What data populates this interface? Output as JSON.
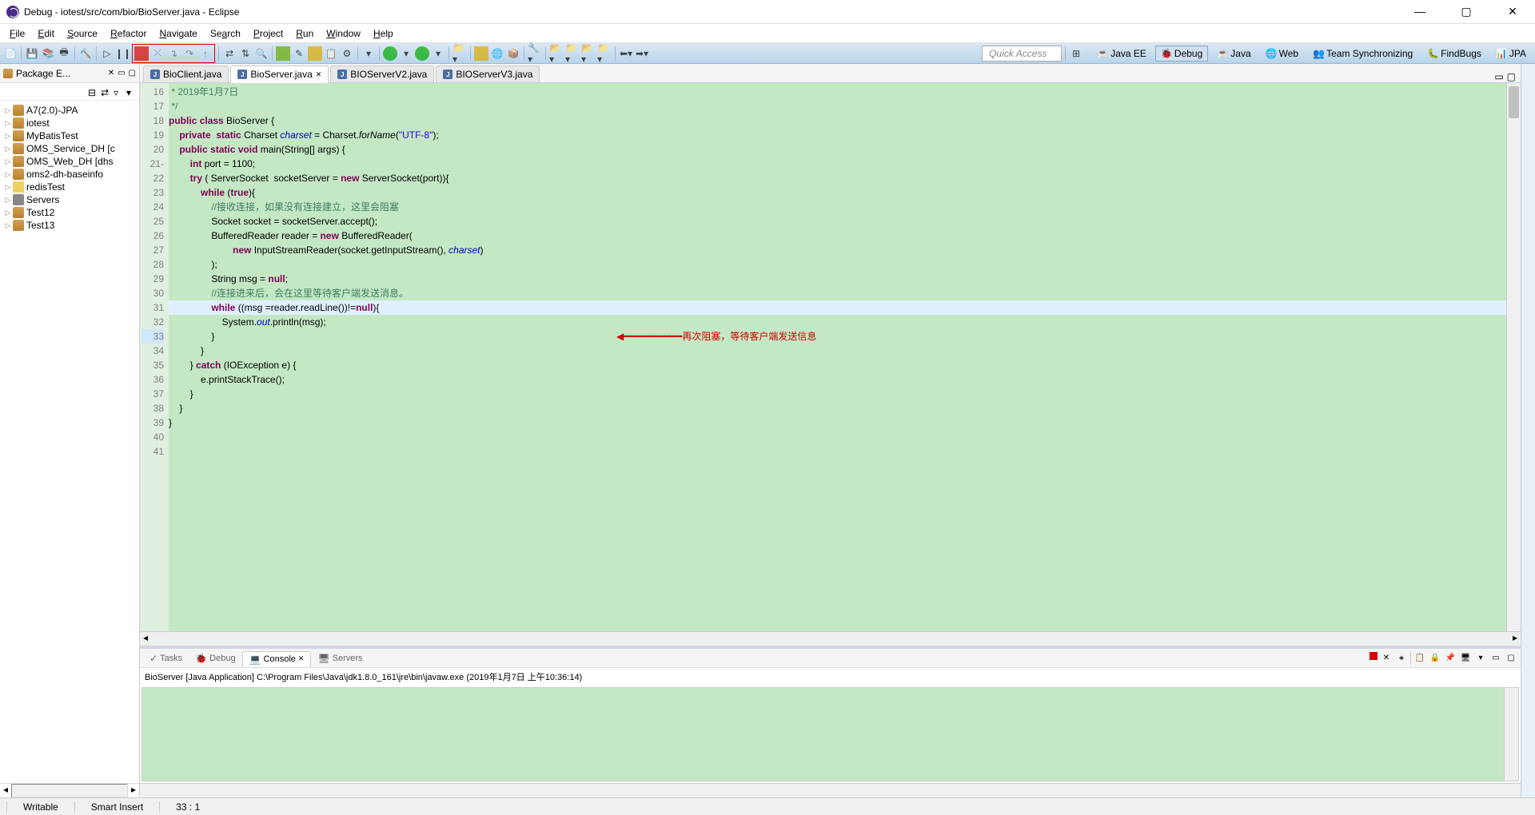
{
  "title": "Debug - iotest/src/com/bio/BioServer.java - Eclipse",
  "menu": [
    "File",
    "Edit",
    "Source",
    "Refactor",
    "Navigate",
    "Search",
    "Project",
    "Run",
    "Window",
    "Help"
  ],
  "menuKeys": [
    "F",
    "E",
    "S",
    "R",
    "N",
    "a",
    "P",
    "R",
    "W",
    "H"
  ],
  "quickAccess": "Quick Access",
  "perspectives": [
    {
      "label": "Java EE",
      "icon": "javaee"
    },
    {
      "label": "Debug",
      "icon": "debug",
      "active": true
    },
    {
      "label": "Java",
      "icon": "java"
    },
    {
      "label": "Web",
      "icon": "web"
    },
    {
      "label": "Team Synchronizing",
      "icon": "team"
    },
    {
      "label": "FindBugs",
      "icon": "findbugs"
    },
    {
      "label": "JPA",
      "icon": "jpa"
    }
  ],
  "packageExplorer": {
    "title": "Package E...",
    "items": [
      {
        "label": "A7(2.0)-JPA",
        "icon": "pkg"
      },
      {
        "label": "iotest",
        "icon": "pkg"
      },
      {
        "label": "MyBatisTest",
        "icon": "pkg"
      },
      {
        "label": "OMS_Service_DH [c",
        "icon": "pkg"
      },
      {
        "label": "OMS_Web_DH [dhs",
        "icon": "pkg"
      },
      {
        "label": "oms2-dh-baseinfo",
        "icon": "pkg"
      },
      {
        "label": "redisTest",
        "icon": "fldr"
      },
      {
        "label": "Servers",
        "icon": "srv"
      },
      {
        "label": "Test12",
        "icon": "pkg"
      },
      {
        "label": "Test13",
        "icon": "pkg"
      }
    ]
  },
  "editorTabs": [
    {
      "label": "BioClient.java"
    },
    {
      "label": "BioServer.java",
      "active": true
    },
    {
      "label": "BIOServerV2.java"
    },
    {
      "label": "BIOServerV3.java"
    }
  ],
  "code": {
    "startLine": 16,
    "currentLine": 33,
    "annotation": "再次阻塞，等待客户端发送信息",
    "lines": [
      {
        "n": 16,
        "t": " * 2019年1月7日",
        "cls": "cmt"
      },
      {
        "n": 17,
        "t": " */",
        "cls": "cmt"
      },
      {
        "n": 18,
        "html": "<span class='kw'>public</span> <span class='kw'>class</span> BioServer {"
      },
      {
        "n": 19,
        "t": ""
      },
      {
        "n": 20,
        "html": "    <span class='kw'>private</span>  <span class='kw'>static</span> Charset <span class='fld'>charset</span> = Charset.<span style='font-style:italic'>forName</span>(<span class='str'>\"UTF-8\"</span>);"
      },
      {
        "n": 21,
        "html": "    <span class='kw'>public</span> <span class='kw'>static</span> <span class='kw'>void</span> main(String[] args) {",
        "mark": "-"
      },
      {
        "n": 22,
        "html": "        <span class='kw'>int</span> port = 1100;"
      },
      {
        "n": 23,
        "t": ""
      },
      {
        "n": 24,
        "html": "        <span class='kw'>try</span> ( ServerSocket  socketServer = <span class='kw'>new</span> ServerSocket(port)){"
      },
      {
        "n": 25,
        "html": "            <span class='kw'>while</span> (<span class='kw'>true</span>){"
      },
      {
        "n": 26,
        "html": "                <span class='cmt'>//接收连接，如果没有连接建立，这里会阻塞</span>"
      },
      {
        "n": 27,
        "html": "                Socket socket = socketServer.accept();"
      },
      {
        "n": 28,
        "html": "                BufferedReader reader = <span class='kw'>new</span> BufferedReader("
      },
      {
        "n": 29,
        "html": "                        <span class='kw'>new</span> InputStreamReader(socket.getInputStream(), <span class='fld'>charset</span>)"
      },
      {
        "n": 30,
        "html": "                );"
      },
      {
        "n": 31,
        "html": "                String msg = <span class='kw'>null</span>;"
      },
      {
        "n": 32,
        "html": "                <span class='cmt'>//连接进来后，会在这里等待客户端发送消息。</span>"
      },
      {
        "n": 33,
        "html": "                <span class='kw'>while</span> ((msg =reader.readLine())!=<span class='kw'>null</span>){",
        "cur": true
      },
      {
        "n": 34,
        "html": "                    System.<span class='fld'>out</span>.println(msg);"
      },
      {
        "n": 35,
        "html": "                }"
      },
      {
        "n": 36,
        "html": "            }"
      },
      {
        "n": 37,
        "html": "        } <span class='kw'>catch</span> (IOException e) {"
      },
      {
        "n": 38,
        "html": "            e.printStackTrace();"
      },
      {
        "n": 39,
        "html": "        }"
      },
      {
        "n": 40,
        "html": "    }"
      },
      {
        "n": 41,
        "html": "}"
      }
    ]
  },
  "consoleTabs": [
    {
      "label": "Tasks"
    },
    {
      "label": "Debug"
    },
    {
      "label": "Console",
      "active": true
    },
    {
      "label": "Servers"
    }
  ],
  "consoleInfo": "BioServer [Java Application] C:\\Program Files\\Java\\jdk1.8.0_161\\jre\\bin\\javaw.exe (2019年1月7日 上午10:36:14)",
  "status": {
    "writable": "Writable",
    "insert": "Smart Insert",
    "pos": "33 : 1"
  }
}
